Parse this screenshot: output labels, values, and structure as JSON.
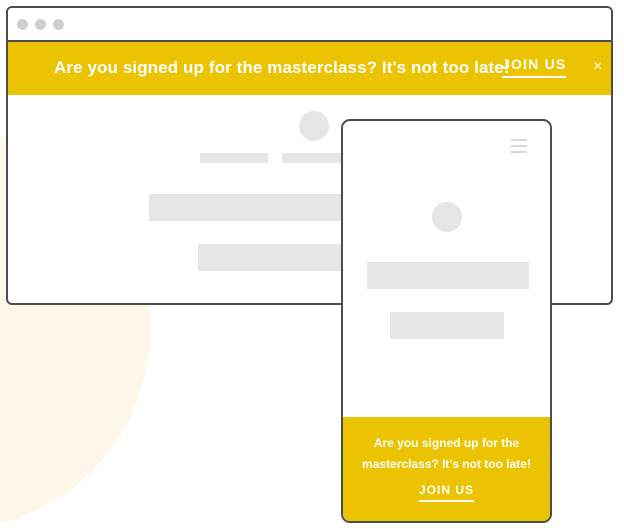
{
  "desktop": {
    "banner": {
      "message": "Are you signed up for the masterclass? It's not too late!",
      "cta_label": "JOIN US",
      "close_glyph": "×"
    }
  },
  "mobile": {
    "banner": {
      "message_line1": "Are you signed up for the",
      "message_line2": "masterclass? It's not too late!",
      "cta_label": "JOIN US"
    },
    "menu_icon": "hamburger-icon"
  },
  "colors": {
    "banner_bg": "#ecc300",
    "frame_border": "#4d4d4d",
    "placeholder": "#e6e6e6",
    "window_dot": "#cfcfcf"
  }
}
